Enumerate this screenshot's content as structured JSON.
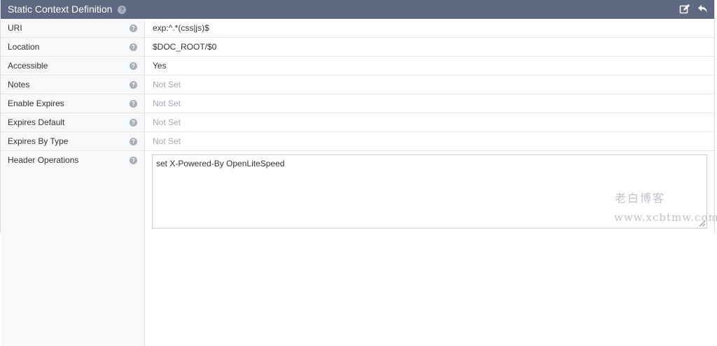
{
  "header": {
    "title": "Static Context Definition",
    "help_icon": "question-circle-icon",
    "actions": [
      {
        "icon": "edit-icon"
      },
      {
        "icon": "undo-icon"
      }
    ]
  },
  "rows": [
    {
      "label": "URI",
      "value": "exp:^.*(css|js)$",
      "muted": false
    },
    {
      "label": "Location",
      "value": "$DOC_ROOT/$0",
      "muted": false
    },
    {
      "label": "Accessible",
      "value": "Yes",
      "muted": false
    },
    {
      "label": "Notes",
      "value": "Not Set",
      "muted": true
    },
    {
      "label": "Enable Expires",
      "value": "Not Set",
      "muted": true
    },
    {
      "label": "Expires Default",
      "value": "Not Set",
      "muted": true
    },
    {
      "label": "Expires By Type",
      "value": "Not Set",
      "muted": true
    }
  ],
  "header_operations": {
    "label": "Header Operations",
    "value": "set X-Powered-By OpenLiteSpeed"
  },
  "watermark": {
    "cn": "老白博客",
    "url": "www.xcbtmw.com"
  },
  "colors": {
    "header_bg": "#5f6a82",
    "label_bg": "#f7f8fa",
    "muted_text": "#a3a8b0"
  }
}
